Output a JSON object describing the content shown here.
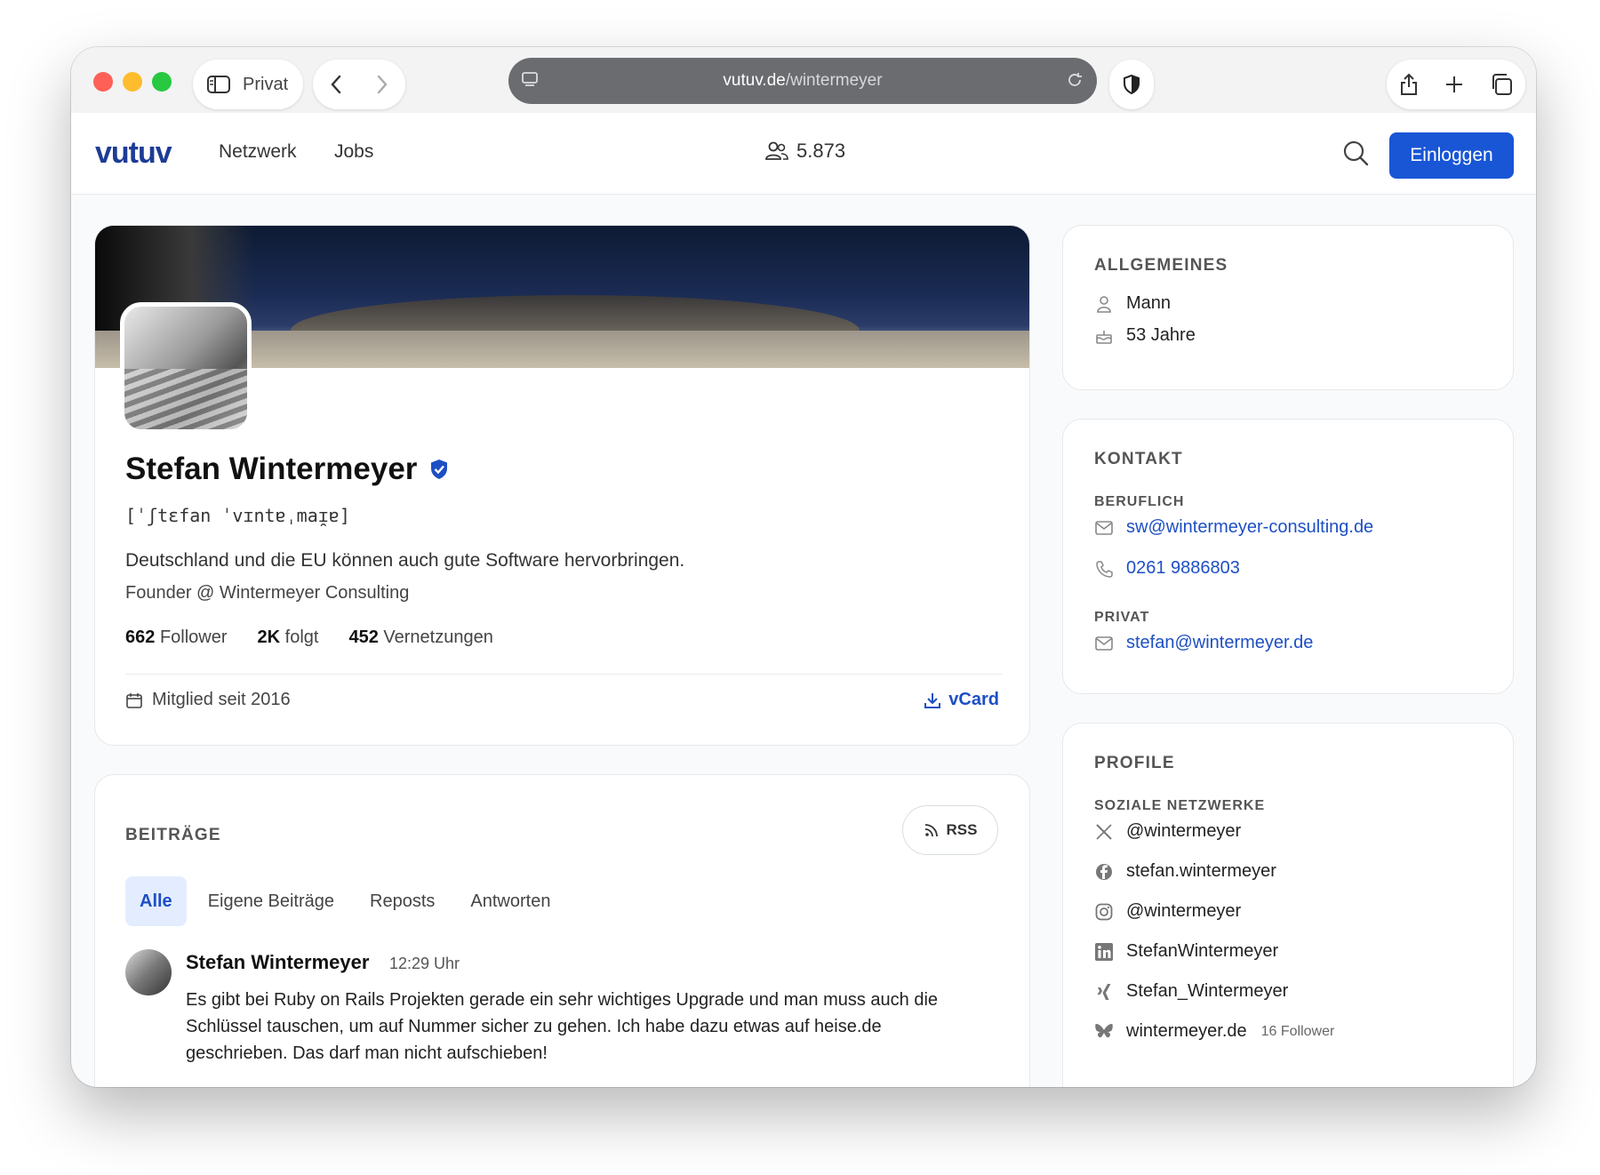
{
  "browser": {
    "private_label": "Privat",
    "url_host": "vutuv.de",
    "url_path": "/wintermeyer"
  },
  "header": {
    "logo": "vutuv",
    "nav": [
      "Netzwerk",
      "Jobs"
    ],
    "user_count": "5.873",
    "login_label": "Einloggen"
  },
  "profile": {
    "name": "Stefan Wintermeyer",
    "phonetic": "[ˈʃtɛfan ˈvɪntɐˌmaɪ̯ɐ]",
    "bio": "Deutschland und die EU können auch gute Software hervorbringen.",
    "headline": "Founder @ Wintermeyer Consulting",
    "stats": {
      "followers_num": "662",
      "followers_label": "Follower",
      "following_num": "2K",
      "following_label": "folgt",
      "connections_num": "452",
      "connections_label": "Vernetzungen"
    },
    "member_since": "Mitglied seit 2016",
    "vcard_label": "vCard"
  },
  "posts": {
    "title": "BEITRÄGE",
    "rss_label": "RSS",
    "tabs": [
      "Alle",
      "Eigene Beiträge",
      "Reposts",
      "Antworten"
    ],
    "active_tab": "Alle",
    "items": [
      {
        "author": "Stefan Wintermeyer",
        "time": "12:29 Uhr",
        "text": "Es gibt bei Ruby on Rails Projekten gerade ein sehr wichtiges Upgrade und man muss auch die Schlüssel tauschen, um auf Nummer sicher zu gehen. Ich habe dazu etwas auf heise.de geschrieben. Das darf man nicht aufschieben!"
      }
    ]
  },
  "general": {
    "title": "ALLGEMEINES",
    "gender": "Mann",
    "age": "53 Jahre"
  },
  "contact": {
    "title": "KONTAKT",
    "work_label": "BERUFLICH",
    "work_email": "sw@wintermeyer-consulting.de",
    "work_phone": "0261 9886803",
    "private_label": "PRIVAT",
    "private_email": "stefan@wintermeyer.de"
  },
  "profiles": {
    "title": "PROFILE",
    "social_label": "SOZIALE NETZWERKE",
    "items": [
      {
        "icon": "x-icon",
        "handle": "@wintermeyer"
      },
      {
        "icon": "facebook-icon",
        "handle": "stefan.wintermeyer"
      },
      {
        "icon": "instagram-icon",
        "handle": "@wintermeyer"
      },
      {
        "icon": "linkedin-icon",
        "handle": "StefanWintermeyer"
      },
      {
        "icon": "xing-icon",
        "handle": "Stefan_Wintermeyer"
      },
      {
        "icon": "bluesky-icon",
        "handle": "wintermeyer.de",
        "extra": "16 Follower"
      }
    ]
  },
  "colors": {
    "accent": "#1856d6",
    "link": "#1d4fc4",
    "logo": "#1d3c96",
    "tab_active_bg": "#e4edff"
  }
}
